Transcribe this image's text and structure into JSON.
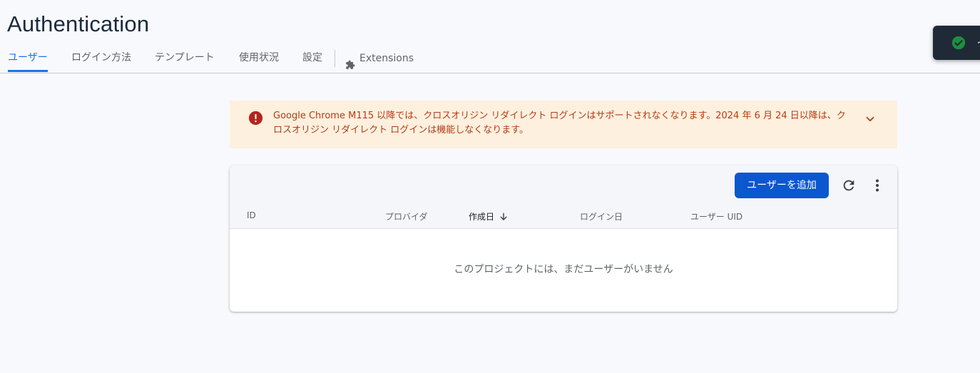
{
  "page": {
    "title": "Authentication"
  },
  "tabs": [
    {
      "label": "ユーザー",
      "active": true
    },
    {
      "label": "ログイン方法",
      "active": false
    },
    {
      "label": "テンプレート",
      "active": false
    },
    {
      "label": "使用状況",
      "active": false
    },
    {
      "label": "設定",
      "active": false
    }
  ],
  "extensions_tab": {
    "label": "Extensions",
    "icon": "puzzle-icon"
  },
  "toast": {
    "icon": "check-circle-icon",
    "text": "セ",
    "icon_color": "#1e8e3e"
  },
  "banner": {
    "icon": "error-icon",
    "message": "Google Chrome M115 以降では、クロスオリジン リダイレクト ログインはサポートされなくなります。2024 年 6 月 24 日以降は、クロスオリジン リダイレクト ログインは機能しなくなります。",
    "expand_icon": "chevron-down-icon",
    "background": "#fef0de",
    "text_color": "#b23c17"
  },
  "users_table": {
    "add_user_label": "ユーザーを追加",
    "refresh_icon": "refresh-icon",
    "more_icon": "more-vert-icon",
    "columns": [
      {
        "label": "ID",
        "sorted": false
      },
      {
        "label": "プロバイダ",
        "sorted": false
      },
      {
        "label": "作成日",
        "sorted": true,
        "sort_icon": "arrow-down-icon"
      },
      {
        "label": "ログイン日",
        "sorted": false
      },
      {
        "label": "ユーザー UID",
        "sorted": false
      }
    ],
    "empty_message": "このプロジェクトには、まだユーザーがいません"
  },
  "colors": {
    "accent": "#1a73e8",
    "primary_button": "#0b57d0",
    "background": "#f8f9fd"
  }
}
